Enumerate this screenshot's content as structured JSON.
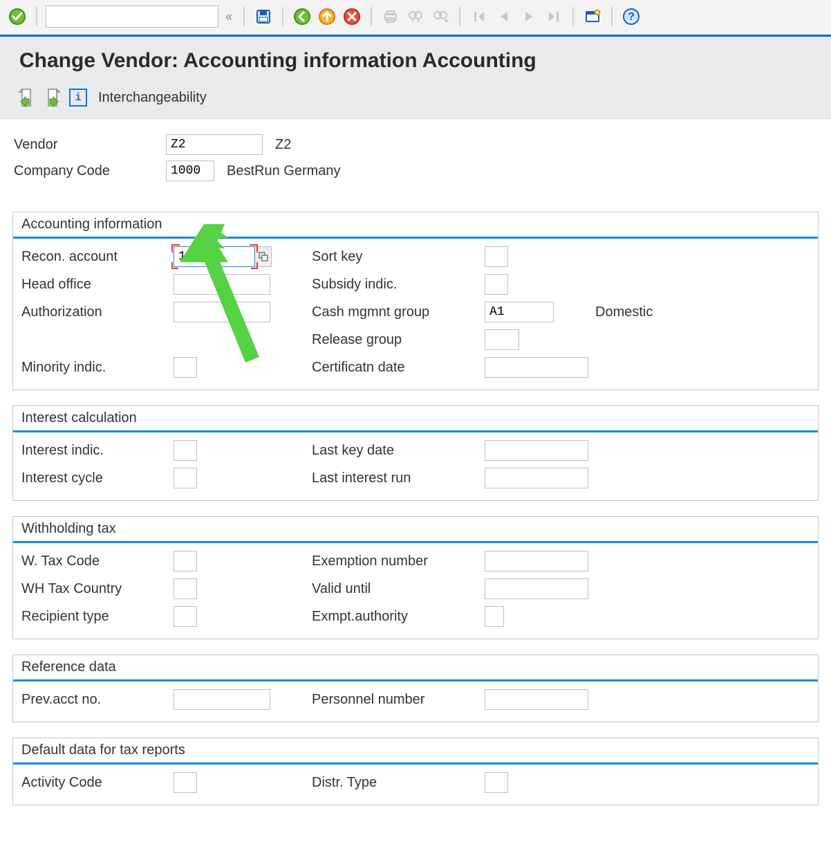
{
  "toolbar": {
    "command_value": ""
  },
  "page_title": "Change Vendor: Accounting information Accounting",
  "app_toolbar": {
    "interchangeability_label": "Interchangeability"
  },
  "header": {
    "vendor_label": "Vendor",
    "vendor_value": "Z2",
    "vendor_text": "Z2",
    "company_code_label": "Company Code",
    "company_code_value": "1000",
    "company_code_text": "BestRun Germany"
  },
  "sections": {
    "accounting_info": {
      "title": "Accounting information",
      "recon_account_label": "Recon. account",
      "recon_account_value": "164004",
      "head_office_label": "Head office",
      "head_office_value": "",
      "authorization_label": "Authorization",
      "authorization_value": "",
      "minority_indic_label": "Minority indic.",
      "minority_indic_value": "",
      "sort_key_label": "Sort key",
      "sort_key_value": "",
      "subsidy_indic_label": "Subsidy indic.",
      "subsidy_indic_value": "",
      "cash_mgmnt_group_label": "Cash mgmnt group",
      "cash_mgmnt_group_value": "A1",
      "cash_mgmnt_group_text": "Domestic",
      "release_group_label": "Release group",
      "release_group_value": "",
      "certificatn_date_label": "Certificatn date",
      "certificatn_date_value": ""
    },
    "interest_calc": {
      "title": "Interest calculation",
      "interest_indic_label": "Interest indic.",
      "interest_indic_value": "",
      "interest_cycle_label": "Interest cycle",
      "interest_cycle_value": "",
      "last_key_date_label": "Last key date",
      "last_key_date_value": "",
      "last_interest_run_label": "Last interest run",
      "last_interest_run_value": ""
    },
    "withholding_tax": {
      "title": "Withholding tax",
      "w_tax_code_label": "W. Tax Code",
      "w_tax_code_value": "",
      "wh_tax_country_label": "WH Tax Country",
      "wh_tax_country_value": "",
      "recipient_type_label": "Recipient type",
      "recipient_type_value": "",
      "exemption_number_label": "Exemption number",
      "exemption_number_value": "",
      "valid_until_label": "Valid  until",
      "valid_until_value": "",
      "exmpt_authority_label": "Exmpt.authority",
      "exmpt_authority_value": ""
    },
    "reference_data": {
      "title": "Reference data",
      "prev_acct_no_label": "Prev.acct no.",
      "prev_acct_no_value": "",
      "personnel_number_label": "Personnel number",
      "personnel_number_value": ""
    },
    "default_tax": {
      "title": "Default data for tax reports",
      "activity_code_label": "Activity Code",
      "activity_code_value": "",
      "distr_type_label": "Distr. Type",
      "distr_type_value": ""
    }
  }
}
